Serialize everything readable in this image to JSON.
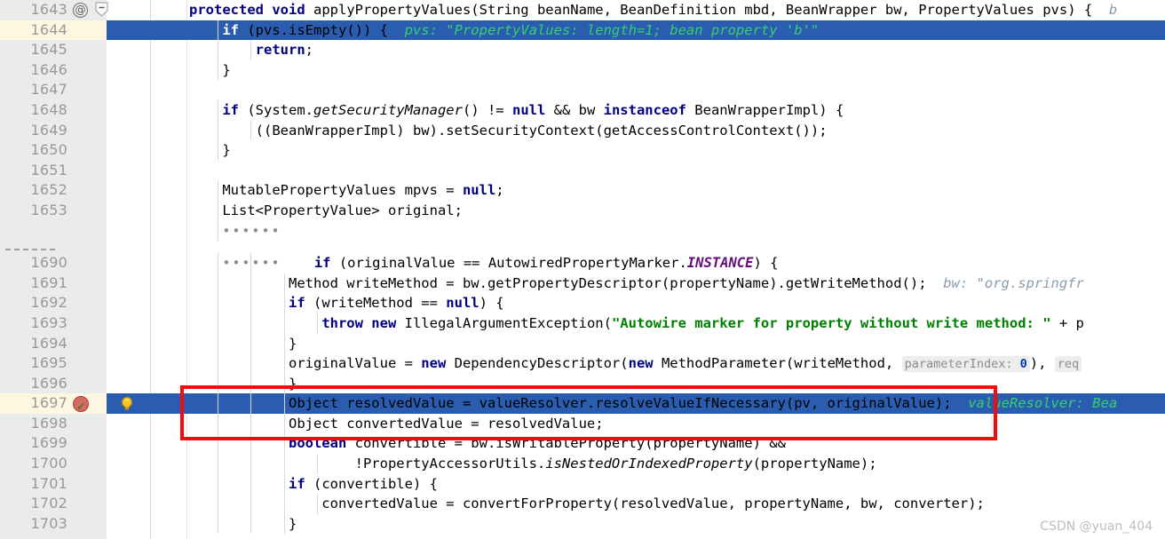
{
  "editor": {
    "watermark": "CSDN @yuan_404",
    "gutter": {
      "annotation_marker": "@",
      "breakpoint_line": "1697",
      "current_line": "1697",
      "execution_lines": [
        "1644",
        "1697"
      ]
    },
    "colors": {
      "execution_highlight": "#2a5db0",
      "current_line_gutter": "#fdf7e2",
      "keyword": "#000080",
      "string": "#008000",
      "static_field": "#660e7a",
      "debug_hint": "#8a9cb0",
      "debug_hint_selected": "#35d06a",
      "annotation_box": "#f40c0c",
      "gutter_bg": "#ebebeb",
      "line_number": "#999999"
    },
    "lines": [
      {
        "num": "1643",
        "state": "normal",
        "icon": "at-icon",
        "fold": "collapse",
        "indent": 0,
        "tokens": [
          {
            "t": "kw",
            "v": "protected "
          },
          {
            "t": "kw",
            "v": "void "
          },
          {
            "t": "plain",
            "v": "applyPropertyValues(String beanName, BeanDefinition mbd, BeanWrapper bw, PropertyValues pvs) {"
          },
          {
            "t": "hint",
            "v": "  b"
          }
        ]
      },
      {
        "num": "1644",
        "state": "exec",
        "indent": 1,
        "tokens": [
          {
            "t": "plain",
            "v": "    "
          },
          {
            "t": "kw",
            "v": "if"
          },
          {
            "t": "plain",
            "v": " (pvs.isEmpty()) {  "
          },
          {
            "t": "hint",
            "v": "pvs: \"PropertyValues: length=1; bean property 'b'\""
          }
        ]
      },
      {
        "num": "1645",
        "state": "normal",
        "indent": 2,
        "tokens": [
          {
            "t": "plain",
            "v": "        "
          },
          {
            "t": "kw",
            "v": "return"
          },
          {
            "t": "plain",
            "v": ";"
          }
        ]
      },
      {
        "num": "1646",
        "state": "normal",
        "indent": 1,
        "tokens": [
          {
            "t": "plain",
            "v": "    }"
          }
        ]
      },
      {
        "num": "1647",
        "state": "normal",
        "indent": 0,
        "tokens": []
      },
      {
        "num": "1648",
        "state": "normal",
        "indent": 1,
        "tokens": [
          {
            "t": "plain",
            "v": "    "
          },
          {
            "t": "kw",
            "v": "if"
          },
          {
            "t": "plain",
            "v": " (System."
          },
          {
            "t": "mi",
            "v": "getSecurityManager"
          },
          {
            "t": "plain",
            "v": "() != "
          },
          {
            "t": "kw",
            "v": "null"
          },
          {
            "t": "plain",
            "v": " && bw "
          },
          {
            "t": "kw",
            "v": "instanceof"
          },
          {
            "t": "plain",
            "v": " BeanWrapperImpl) {"
          }
        ]
      },
      {
        "num": "1649",
        "state": "normal",
        "indent": 2,
        "tokens": [
          {
            "t": "plain",
            "v": "        ((BeanWrapperImpl) bw).setSecurityContext(getAccessControlContext());"
          }
        ]
      },
      {
        "num": "1650",
        "state": "normal",
        "indent": 1,
        "tokens": [
          {
            "t": "plain",
            "v": "    }"
          }
        ]
      },
      {
        "num": "1651",
        "state": "normal",
        "indent": 0,
        "tokens": []
      },
      {
        "num": "1652",
        "state": "normal",
        "indent": 1,
        "tokens": [
          {
            "t": "plain",
            "v": "    MutablePropertyValues mpvs = "
          },
          {
            "t": "kw",
            "v": "null"
          },
          {
            "t": "plain",
            "v": ";"
          }
        ]
      },
      {
        "num": "1653",
        "state": "normal",
        "indent": 1,
        "tokens": [
          {
            "t": "plain",
            "v": "    List<PropertyValue> original;"
          }
        ]
      },
      {
        "num": "",
        "state": "fold",
        "indent": 1,
        "tokens": [
          {
            "t": "plain",
            "v": "    "
          },
          {
            "t": "folddots",
            "v": "••••••"
          }
        ]
      },
      {
        "num": "",
        "state": "foldgap",
        "indent": 0,
        "tokens": []
      },
      {
        "num": "1690",
        "state": "fold-start",
        "indent": 2,
        "tokens": [
          {
            "t": "plain",
            "v": "    "
          },
          {
            "t": "folddots",
            "v": "••••••"
          },
          {
            "t": "plain",
            "v": "    "
          },
          {
            "t": "kw",
            "v": "if"
          },
          {
            "t": "plain",
            "v": " (originalValue == AutowiredPropertyMarker."
          },
          {
            "t": "stat",
            "v": "INSTANCE"
          },
          {
            "t": "plain",
            "v": ") {"
          }
        ]
      },
      {
        "num": "1691",
        "state": "normal",
        "indent": 3,
        "tokens": [
          {
            "t": "plain",
            "v": "            Method writeMethod = bw.getPropertyDescriptor(propertyName).getWriteMethod();  "
          },
          {
            "t": "hint",
            "v": "bw: \"org.springfr"
          }
        ]
      },
      {
        "num": "1692",
        "state": "normal",
        "indent": 3,
        "tokens": [
          {
            "t": "plain",
            "v": "            "
          },
          {
            "t": "kw",
            "v": "if"
          },
          {
            "t": "plain",
            "v": " (writeMethod == "
          },
          {
            "t": "kw",
            "v": "null"
          },
          {
            "t": "plain",
            "v": ") {"
          }
        ]
      },
      {
        "num": "1693",
        "state": "normal",
        "indent": 4,
        "tokens": [
          {
            "t": "plain",
            "v": "                "
          },
          {
            "t": "kw",
            "v": "throw new"
          },
          {
            "t": "plain",
            "v": " IllegalArgumentException("
          },
          {
            "t": "str",
            "v": "\"Autowire marker for property without write method: \""
          },
          {
            "t": "plain",
            "v": " + p"
          }
        ]
      },
      {
        "num": "1694",
        "state": "normal",
        "indent": 3,
        "tokens": [
          {
            "t": "plain",
            "v": "            }"
          }
        ]
      },
      {
        "num": "1695",
        "state": "normal",
        "indent": 3,
        "tokens": [
          {
            "t": "plain",
            "v": "            originalValue = "
          },
          {
            "t": "kw",
            "v": "new"
          },
          {
            "t": "plain",
            "v": " DependencyDescriptor("
          },
          {
            "t": "kw",
            "v": "new"
          },
          {
            "t": "plain",
            "v": " MethodParameter(writeMethod, "
          },
          {
            "t": "pill",
            "v": "parameterIndex:",
            "pv": "0"
          },
          {
            "t": "plain",
            "v": "), "
          },
          {
            "t": "pill2",
            "v": "req"
          }
        ]
      },
      {
        "num": "1696",
        "state": "normal",
        "indent": 3,
        "tokens": [
          {
            "t": "plain",
            "v": "            }"
          }
        ]
      },
      {
        "num": "1697",
        "state": "exec",
        "icon": "breakpoint",
        "bulb": true,
        "indent": 3,
        "tokens": [
          {
            "t": "plain",
            "v": "            Object resolvedValue = valueResolver.resolveValueIfNecessary(pv, originalValue);  "
          },
          {
            "t": "hint",
            "v": "valueResolver: Bea"
          }
        ]
      },
      {
        "num": "1698",
        "state": "normal",
        "indent": 3,
        "tokens": [
          {
            "t": "plain",
            "v": "            Object convertedValue = resolvedValue;"
          }
        ]
      },
      {
        "num": "1699",
        "state": "normal",
        "indent": 3,
        "tokens": [
          {
            "t": "plain",
            "v": "            "
          },
          {
            "t": "kw",
            "v": "boolean"
          },
          {
            "t": "plain",
            "v": " convertible = bw.isWritableProperty(propertyName) &&"
          }
        ]
      },
      {
        "num": "1700",
        "state": "normal",
        "indent": 4,
        "tokens": [
          {
            "t": "plain",
            "v": "                    !PropertyAccessorUtils."
          },
          {
            "t": "mi",
            "v": "isNestedOrIndexedProperty"
          },
          {
            "t": "plain",
            "v": "(propertyName);"
          }
        ]
      },
      {
        "num": "1701",
        "state": "normal",
        "indent": 3,
        "tokens": [
          {
            "t": "plain",
            "v": "            "
          },
          {
            "t": "kw",
            "v": "if"
          },
          {
            "t": "plain",
            "v": " (convertible) {"
          }
        ]
      },
      {
        "num": "1702",
        "state": "normal",
        "indent": 4,
        "tokens": [
          {
            "t": "plain",
            "v": "                convertedValue = convertForProperty(resolvedValue, propertyName, bw, converter);"
          }
        ]
      },
      {
        "num": "1703",
        "state": "normal",
        "indent": 3,
        "tokens": [
          {
            "t": "plain",
            "v": "            }"
          }
        ]
      }
    ]
  }
}
